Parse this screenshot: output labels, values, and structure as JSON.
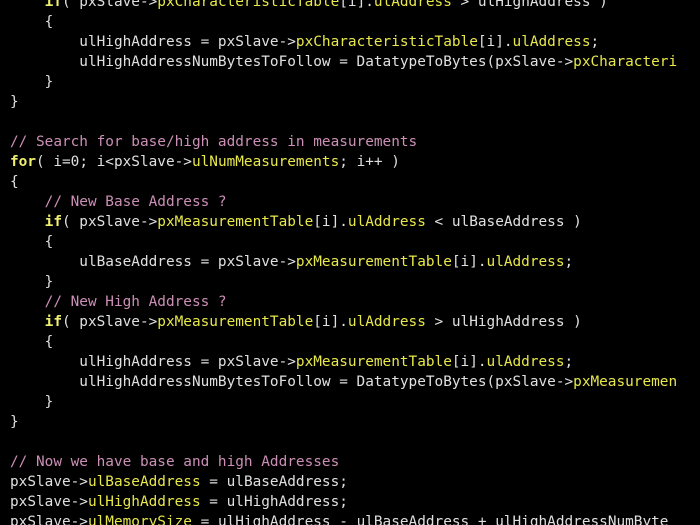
{
  "lines": [
    [
      [
        "keyword",
        "    if"
      ],
      [
        "plain",
        "( pxSlave->"
      ],
      [
        "member",
        "pxCharacteristicTable"
      ],
      [
        "plain",
        "[i]."
      ],
      [
        "member",
        "ulAddress"
      ],
      [
        "plain",
        " > ulHighAddress )"
      ]
    ],
    [
      [
        "plain",
        "    {"
      ]
    ],
    [
      [
        "plain",
        "        ulHighAddress = pxSlave->"
      ],
      [
        "member",
        "pxCharacteristicTable"
      ],
      [
        "plain",
        "[i]."
      ],
      [
        "member",
        "ulAddress"
      ],
      [
        "plain",
        ";"
      ]
    ],
    [
      [
        "plain",
        "        ulHighAddressNumBytesToFollow = DatatypeToBytes(pxSlave->"
      ],
      [
        "member",
        "pxCharacteri"
      ]
    ],
    [
      [
        "plain",
        "    }"
      ]
    ],
    [
      [
        "plain",
        "}"
      ]
    ],
    [],
    [
      [
        "comment",
        "// Search for base/high address in measurements"
      ]
    ],
    [
      [
        "keyword",
        "for"
      ],
      [
        "plain",
        "( i=0; i<pxSlave->"
      ],
      [
        "member",
        "ulNumMeasurements"
      ],
      [
        "plain",
        "; i++ )"
      ]
    ],
    [
      [
        "plain",
        "{"
      ]
    ],
    [
      [
        "comment",
        "    // New Base Address ?"
      ]
    ],
    [
      [
        "keyword",
        "    if"
      ],
      [
        "plain",
        "( pxSlave->"
      ],
      [
        "member",
        "pxMeasurementTable"
      ],
      [
        "plain",
        "[i]."
      ],
      [
        "member",
        "ulAddress"
      ],
      [
        "plain",
        " < ulBaseAddress )"
      ]
    ],
    [
      [
        "plain",
        "    {"
      ]
    ],
    [
      [
        "plain",
        "        ulBaseAddress = pxSlave->"
      ],
      [
        "member",
        "pxMeasurementTable"
      ],
      [
        "plain",
        "[i]."
      ],
      [
        "member",
        "ulAddress"
      ],
      [
        "plain",
        ";"
      ]
    ],
    [
      [
        "plain",
        "    }"
      ]
    ],
    [
      [
        "comment",
        "    // New High Address ?"
      ]
    ],
    [
      [
        "keyword",
        "    if"
      ],
      [
        "plain",
        "( pxSlave->"
      ],
      [
        "member",
        "pxMeasurementTable"
      ],
      [
        "plain",
        "[i]."
      ],
      [
        "member",
        "ulAddress"
      ],
      [
        "plain",
        " > ulHighAddress )"
      ]
    ],
    [
      [
        "plain",
        "    {"
      ]
    ],
    [
      [
        "plain",
        "        ulHighAddress = pxSlave->"
      ],
      [
        "member",
        "pxMeasurementTable"
      ],
      [
        "plain",
        "[i]."
      ],
      [
        "member",
        "ulAddress"
      ],
      [
        "plain",
        ";"
      ]
    ],
    [
      [
        "plain",
        "        ulHighAddressNumBytesToFollow = DatatypeToBytes(pxSlave->"
      ],
      [
        "member",
        "pxMeasuremen"
      ]
    ],
    [
      [
        "plain",
        "    }"
      ]
    ],
    [
      [
        "plain",
        "}"
      ]
    ],
    [],
    [
      [
        "comment",
        "// Now we have base and high Addresses"
      ]
    ],
    [
      [
        "plain",
        "pxSlave->"
      ],
      [
        "member",
        "ulBaseAddress"
      ],
      [
        "plain",
        " = ulBaseAddress;"
      ]
    ],
    [
      [
        "plain",
        "pxSlave->"
      ],
      [
        "member",
        "ulHighAddress"
      ],
      [
        "plain",
        " = ulHighAddress;"
      ]
    ],
    [
      [
        "plain",
        "pxSlave->"
      ],
      [
        "member",
        "ulMemorySize"
      ],
      [
        "plain",
        " = ulHighAddress - ulBaseAddress + ulHighAddressNumByte"
      ]
    ]
  ],
  "colors": {
    "background": "#000000",
    "plain": "#e0e0e0",
    "keyword": "#f0f070",
    "member": "#e8e84a",
    "comment": "#cc8fb6"
  }
}
